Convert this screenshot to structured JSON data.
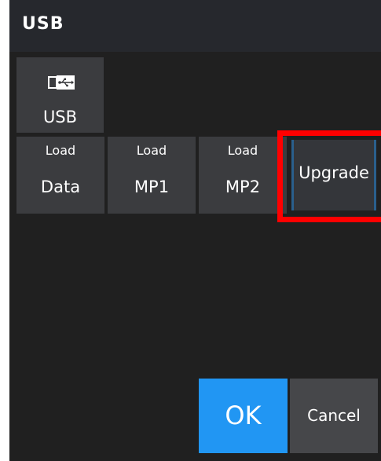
{
  "window": {
    "title": "USB"
  },
  "tiles": {
    "usb": {
      "label": "USB",
      "icon": "usb-icon"
    },
    "load_data": {
      "top": "Load",
      "bottom": "Data"
    },
    "load_mp1": {
      "top": "Load",
      "bottom": "MP1"
    },
    "load_mp2": {
      "top": "Load",
      "bottom": "MP2"
    },
    "upgrade": {
      "label": "Upgrade"
    }
  },
  "buttons": {
    "ok": "OK",
    "cancel": "Cancel"
  },
  "colors": {
    "background": "#202020",
    "title_bar": "#26282d",
    "tile": "#3b3c3f",
    "accent": "#2196f3",
    "highlight": "#ff0000"
  }
}
